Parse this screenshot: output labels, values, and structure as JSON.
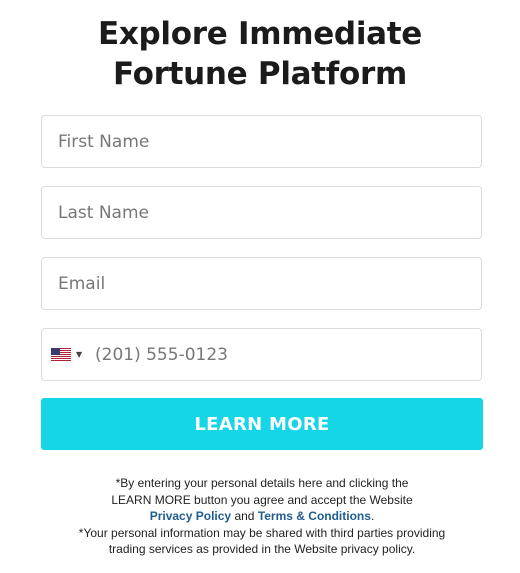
{
  "form": {
    "title_line1": "Explore Immediate",
    "title_line2": "Fortune Platform",
    "first_name_placeholder": "First Name",
    "last_name_placeholder": "Last Name",
    "email_placeholder": "Email",
    "phone_placeholder": "(201) 555-0123",
    "country_flag": "us-flag-icon",
    "submit_label": "LEARN MORE",
    "accent_color": "#14d6e6"
  },
  "disclaimer": {
    "line1": "*By entering your personal details here and clicking the",
    "line2": "LEARN MORE button you agree and accept the Website",
    "privacy_link": "Privacy Policy",
    "and_text": "and",
    "terms_link": "Terms & Conditions",
    "period": ".",
    "line4": "*Your personal information may be shared with third parties providing",
    "line5": "trading services as provided in the Website privacy policy.",
    "link_color": "#1f5c8f"
  }
}
